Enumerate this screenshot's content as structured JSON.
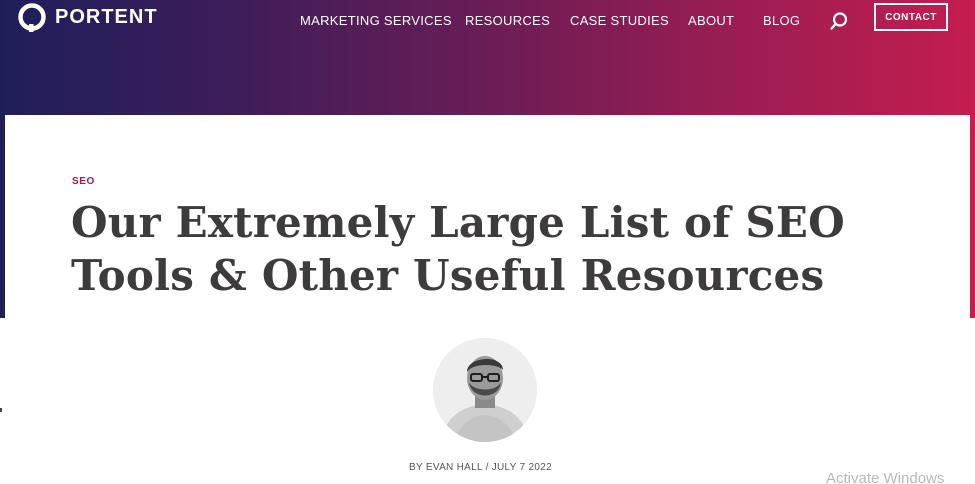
{
  "brand": {
    "name": "PORTENT",
    "logo_icon": "portent-ring-logo-icon"
  },
  "nav": {
    "items": [
      {
        "label": "MARKETING SERVICES"
      },
      {
        "label": "RESOURCES"
      },
      {
        "label": "CASE STUDIES"
      },
      {
        "label": "ABOUT"
      },
      {
        "label": "BLOG"
      }
    ],
    "search_icon": "search-icon",
    "contact_label": "CONTACT"
  },
  "article": {
    "category": "SEO",
    "title": "Our Extremely Large List of SEO Tools & Other Useful Resources",
    "byline": "BY EVAN HALL / JULY 7 2022",
    "author_avatar": "author-avatar-photo"
  },
  "os_overlay": {
    "watermark": "Activate Windows"
  },
  "colors": {
    "gradient_start": "#1e1f5a",
    "gradient_end": "#c41d4f",
    "category_accent": "#b3124a",
    "title_text": "#3d3b3b"
  }
}
